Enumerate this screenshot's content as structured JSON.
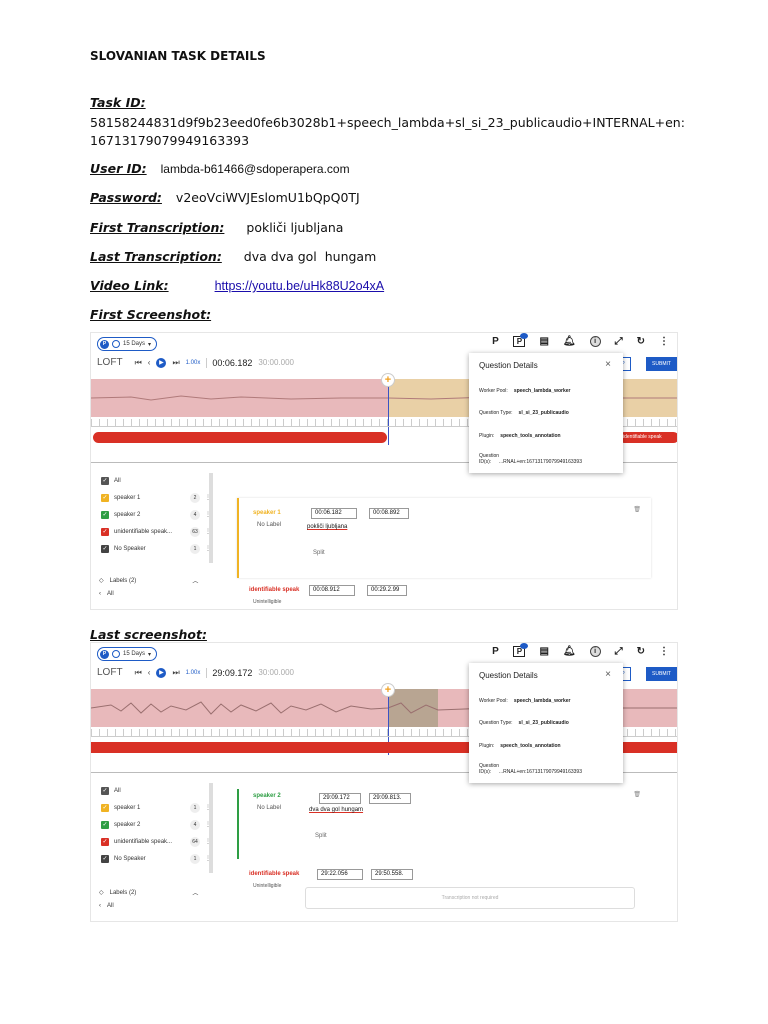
{
  "doc": {
    "title": "SLOVANIAN TASK DETAILS",
    "task_id_label": "Task ID:",
    "task_id_value": "58158244831d9f9b23eed0fe6b3028b1+speech_lambda+sl_si_23_publicaudio+INTERNAL+en:16713179079949163393",
    "user_id_label": "User ID:",
    "user_id_value": "lambda-b61466@sdoperapera.com",
    "password_label": "Password:",
    "password_value": "v2eoVciWVJEslomU1bQpQ0TJ",
    "first_transcription_label": "First Transcription:",
    "first_transcription_value": "pokliči ljubljana",
    "last_transcription_label": "Last Transcription:",
    "last_transcription_value": "dva dva gol  hungam",
    "video_link_label": "Video Link:",
    "video_link_value": "https://youtu.be/uHk88U2o4xA",
    "first_screenshot_label": "First Screenshot:",
    "last_screenshot_label": "Last screenshot:"
  },
  "shots": {
    "toolbar": {
      "chip_text": "15 Days",
      "chip_p": "P",
      "p_label": "P",
      "p2_label": "P",
      "info_label": "i",
      "more_label": "⋮",
      "loft_label": "LOFT",
      "speed": "1.00x",
      "total": "30:00.000",
      "skip": "SKIP",
      "submit": "SUBMIT"
    },
    "popup": {
      "title": "Question Details",
      "close": "×",
      "worker_pool_label": "Worker Pool:",
      "worker_pool_value": "speech_lambda_worker",
      "question_type_label": "Question Type:",
      "question_type_value": "sl_si_23_publicaudio",
      "plugin_label": "Plugin:",
      "plugin_value": "speech_tools_annotation",
      "question_id_label": "Question ID(s):",
      "question_id_value": "...RNAL+en:16713179079949163393"
    },
    "first": {
      "time": "00:06.182",
      "speakers": [
        {
          "label": "All",
          "color": "#555555",
          "count": ""
        },
        {
          "label": "speaker 1",
          "color": "#f0b323",
          "count": "2"
        },
        {
          "label": "speaker 2",
          "color": "#2e9e44",
          "count": "4"
        },
        {
          "label": "unidentifiable speak...",
          "color": "#d93025",
          "count": "63"
        },
        {
          "label": "No Speaker",
          "color": "#444444",
          "count": "1"
        }
      ],
      "labels_header": "Labels (2)",
      "labels_all": "All",
      "seg1_name": "speaker 1",
      "seg1_sub": "No Label",
      "seg1_start": "00:06.182",
      "seg1_end": "00:08.892",
      "seg1_text": "pokliči ljubljana",
      "seg1_split": "Split",
      "seg2_name": "identifiable speak",
      "seg2_sub": "Unintelligible",
      "seg2_start": "00:08.912",
      "seg2_end": "00:29.2.99",
      "red_label": "identifiable speak"
    },
    "last": {
      "time": "29:09.172",
      "speakers": [
        {
          "label": "All",
          "color": "#555555",
          "count": ""
        },
        {
          "label": "speaker 1",
          "color": "#f0b323",
          "count": "1"
        },
        {
          "label": "speaker 2",
          "color": "#2e9e44",
          "count": "4"
        },
        {
          "label": "unidentifiable speak...",
          "color": "#d93025",
          "count": "64"
        },
        {
          "label": "No Speaker",
          "color": "#444444",
          "count": "1"
        }
      ],
      "labels_header": "Labels (2)",
      "labels_all": "All",
      "seg1_name": "speaker 2",
      "seg1_sub": "No Label",
      "seg1_start": "29:09.172",
      "seg1_end": "29:09.813.",
      "seg1_text": "dva dva gol hungam",
      "seg1_split": "Split",
      "seg2_name": "identifiable speak",
      "seg2_sub": "Unintelligible",
      "seg2_start": "29:22.056",
      "seg2_end": "29:50.558.",
      "seg2_note": "Transcription not required"
    }
  }
}
